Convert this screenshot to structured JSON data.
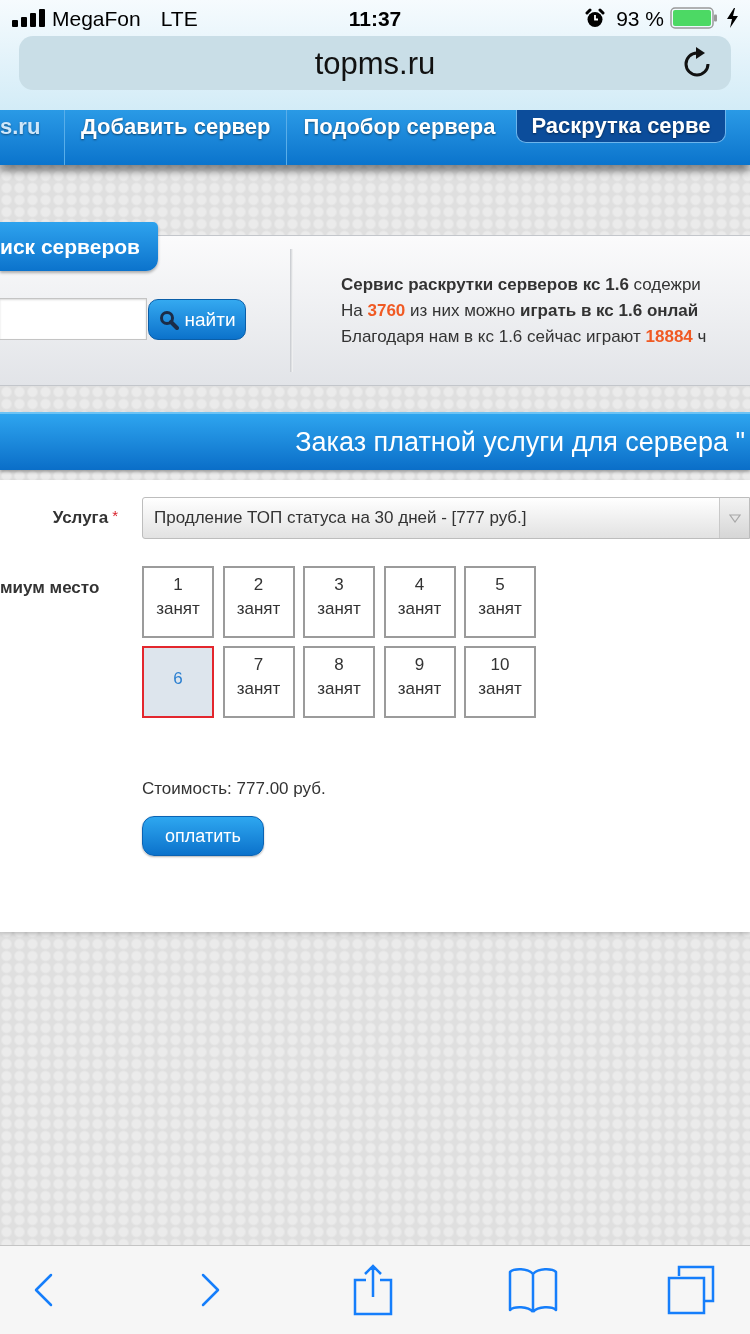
{
  "status_bar": {
    "carrier": "MegaFon",
    "network": "LTE",
    "time": "11:37",
    "battery": "93 %"
  },
  "address_bar": {
    "url": "topms.ru"
  },
  "site_nav": {
    "logo": "s.ru",
    "items": [
      {
        "label": "Добавить сервер",
        "selected": false
      },
      {
        "label": "Подобор сервера",
        "selected": false
      },
      {
        "label": "Раскрутка серве",
        "selected": true
      }
    ]
  },
  "search_panel": {
    "title": "иск серверов",
    "button": "найти",
    "info_lines": [
      {
        "segments": [
          {
            "kind": "bold",
            "text": "Сервис раскрутки серверов кс 1.6"
          },
          {
            "kind": "plain",
            "text": " содежри"
          }
        ]
      },
      {
        "segments": [
          {
            "kind": "plain",
            "text": "На "
          },
          {
            "kind": "number",
            "text": "3760"
          },
          {
            "kind": "plain",
            "text": " из них можно "
          },
          {
            "kind": "bold",
            "text": "играть в кс 1.6 онлай"
          }
        ]
      },
      {
        "segments": [
          {
            "kind": "plain",
            "text": "Благодаря нам в кс 1.6 сейчас играют "
          },
          {
            "kind": "number",
            "text": "18884"
          },
          {
            "kind": "plain",
            "text": " ч"
          }
        ]
      }
    ]
  },
  "order": {
    "title": "Заказ платной услуги для сервера \"",
    "service": {
      "label": "Услуга",
      "required_mark": "*",
      "value": "Продление ТОП статуса на 30 дней - [777 руб.]"
    },
    "place": {
      "label": "миум место",
      "slots": [
        {
          "number": "1",
          "status": "занят",
          "selected": false
        },
        {
          "number": "2",
          "status": "занят",
          "selected": false
        },
        {
          "number": "3",
          "status": "занят",
          "selected": false
        },
        {
          "number": "4",
          "status": "занят",
          "selected": false
        },
        {
          "number": "5",
          "status": "занят",
          "selected": false
        },
        {
          "number": "6",
          "selected": true
        },
        {
          "number": "7",
          "status": "занят",
          "selected": false
        },
        {
          "number": "8",
          "status": "занят",
          "selected": false
        },
        {
          "number": "9",
          "status": "занят",
          "selected": false
        },
        {
          "number": "10",
          "status": "занят",
          "selected": false
        }
      ]
    },
    "cost": "Стоимость: 777.00 руб.",
    "pay_button": "оплатить"
  }
}
